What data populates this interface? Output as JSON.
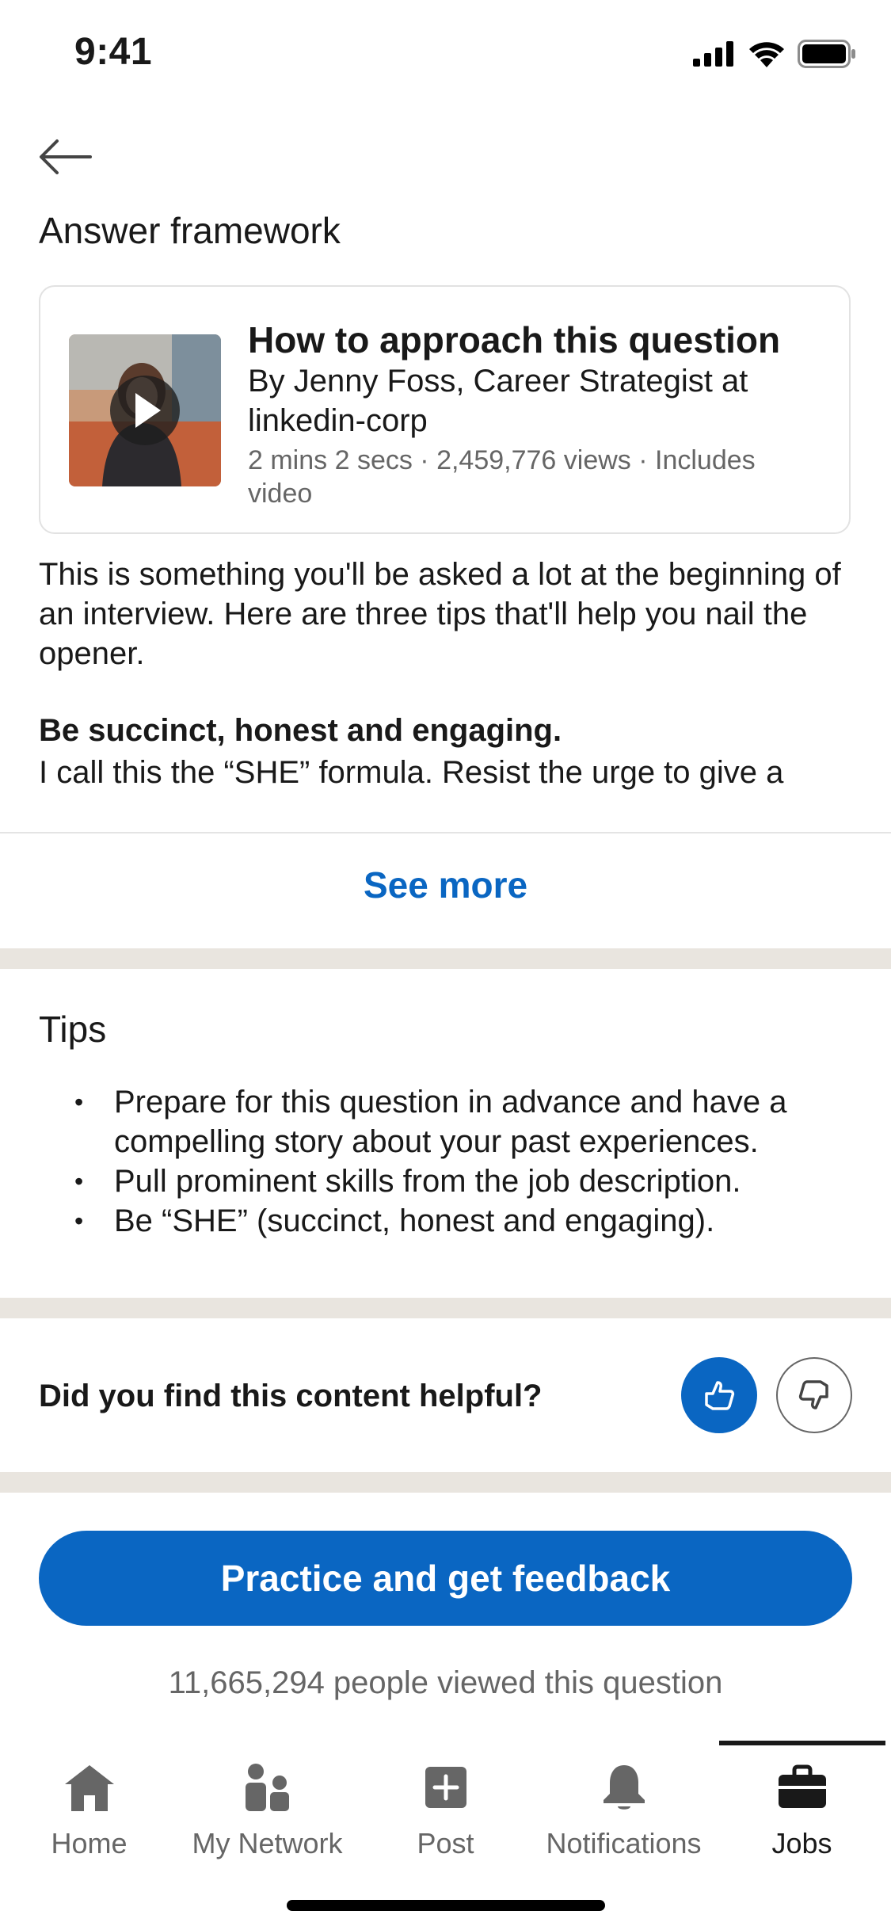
{
  "status_bar": {
    "time": "9:41"
  },
  "header": {
    "section_title": "Answer framework"
  },
  "video_card": {
    "title": "How to approach this question",
    "author": "By Jenny Foss, Career Strategist at linkedin-corp",
    "meta": "2 mins 2 secs · 2,459,776 views · Includes video"
  },
  "article": {
    "intro": "This is something you'll be asked a lot at the beginning of an interview. Here are three tips that'll help you nail the opener.",
    "bold_heading": "Be succinct, honest and engaging.",
    "truncated_line": "I call this the “SHE” formula. Resist the urge to give a",
    "see_more": "See more"
  },
  "tips": {
    "title": "Tips",
    "items": [
      "Prepare for this question in advance and have a compelling story about your past experiences.",
      "Pull prominent skills from the job description.",
      "Be “SHE” (succinct, honest and engaging)."
    ]
  },
  "feedback": {
    "question": "Did you find this content helpful?"
  },
  "cta": {
    "button_label": "Practice and get feedback",
    "views": "11,665,294 people viewed this question"
  },
  "bottom_nav": {
    "items": [
      {
        "label": "Home",
        "icon": "home-icon"
      },
      {
        "label": "My Network",
        "icon": "network-icon"
      },
      {
        "label": "Post",
        "icon": "post-icon"
      },
      {
        "label": "Notifications",
        "icon": "bell-icon"
      },
      {
        "label": "Jobs",
        "icon": "briefcase-icon",
        "active": true
      }
    ]
  },
  "colors": {
    "accent": "#0a66c2",
    "text_primary": "#191919",
    "text_secondary": "#666666",
    "section_band": "#e9e5df"
  }
}
